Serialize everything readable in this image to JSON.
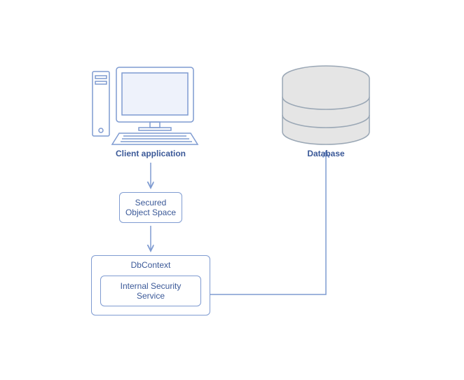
{
  "nodes": {
    "client_application": {
      "label": "Client application"
    },
    "database": {
      "label": "Database"
    },
    "secured_object_space": {
      "label": "Secured\nObject Space"
    },
    "dbcontext": {
      "label": "DbContext"
    },
    "internal_security_service": {
      "label": "Internal Security\nService"
    }
  },
  "colors": {
    "stroke": "#7f9bd1",
    "text": "#3b5998",
    "db_fill": "#e5e5e5"
  }
}
